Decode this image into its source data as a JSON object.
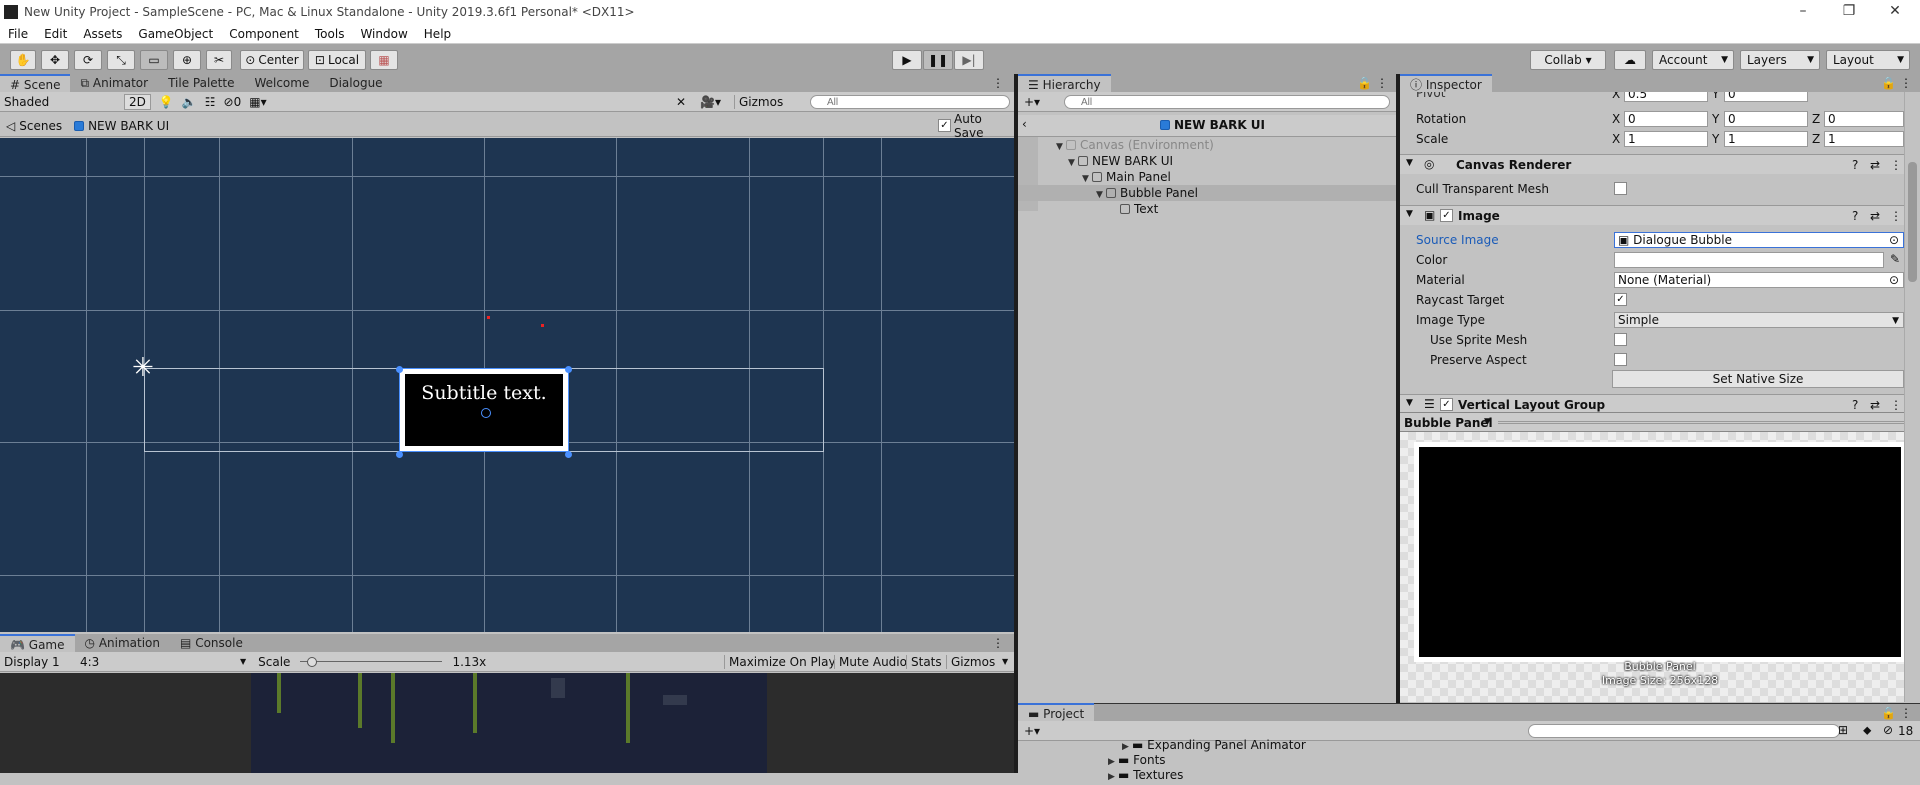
{
  "window": {
    "title": "New Unity Project - SampleScene - PC, Mac & Linux Standalone - Unity 2019.3.6f1 Personal* <DX11>",
    "controls": [
      "–",
      "❐",
      "✕"
    ]
  },
  "menu": [
    "File",
    "Edit",
    "Assets",
    "GameObject",
    "Component",
    "Tools",
    "Window",
    "Help"
  ],
  "toolbar": {
    "pivot_label": "Center",
    "space_label": "Local",
    "collab_label": "Collab ▾",
    "account_label": "Account",
    "layers_label": "Layers",
    "layout_label": "Layout"
  },
  "scene_tabs": [
    "Scene",
    "Animator",
    "Tile Palette",
    "Welcome",
    "Dialogue"
  ],
  "scene_bar": {
    "shading": "Shaded",
    "mode_2d": "2D",
    "hidden_count": "0",
    "gizmos": "Gizmos",
    "search_placeholder": "All"
  },
  "breadcrumb": {
    "scenes": "Scenes",
    "current": "NEW BARK UI",
    "auto_save": "Auto Save"
  },
  "scene_content": {
    "subtitle": "Subtitle text."
  },
  "game_tabs": [
    "Game",
    "Animation",
    "Console"
  ],
  "game_bar": {
    "display": "Display 1",
    "aspect": "4:3",
    "scale_label": "Scale",
    "scale_value": "1.13x",
    "scale_level": 0.05,
    "maximize": "Maximize On Play",
    "mute": "Mute Audio",
    "stats": "Stats",
    "gizmos": "Gizmos"
  },
  "hierarchy": {
    "tab": "Hierarchy",
    "search_placeholder": "All",
    "scene_title": "NEW BARK UI",
    "items": [
      {
        "label": "Canvas (Environment)"
      },
      {
        "label": "NEW BARK UI"
      },
      {
        "label": "Main Panel"
      },
      {
        "label": "Bubble Panel"
      },
      {
        "label": "Text"
      }
    ]
  },
  "inspector": {
    "tab": "Inspector",
    "pivot_label": "Pivot",
    "pivot_x": "0.5",
    "pivot_y": "0",
    "rotation": {
      "label": "Rotation",
      "x": "0",
      "y": "0",
      "z": "0"
    },
    "scale": {
      "label": "Scale",
      "x": "1",
      "y": "1",
      "z": "1"
    },
    "axes": [
      "X",
      "Y",
      "Z"
    ],
    "canvas_renderer": {
      "title": "Canvas Renderer",
      "cull_label": "Cull Transparent Mesh"
    },
    "image": {
      "title": "Image",
      "source_label": "Source Image",
      "source_value": "Dialogue Bubble",
      "color_label": "Color",
      "material_label": "Material",
      "material_value": "None (Material)",
      "raycast_label": "Raycast Target",
      "type_label": "Image Type",
      "type_value": "Simple",
      "sprite_mesh_label": "Use Sprite Mesh",
      "aspect_label": "Preserve Aspect",
      "native_size": "Set Native Size"
    },
    "vlg": {
      "title": "Vertical Layout Group"
    },
    "preview": {
      "object": "Bubble Panel",
      "caption_1": "Bubble Panel",
      "caption_2": "Image Size: 256x128"
    }
  },
  "project": {
    "tab": "Project",
    "items": [
      "Expanding Panel Animator",
      "Fonts",
      "Textures"
    ],
    "hidden_count": "18"
  }
}
